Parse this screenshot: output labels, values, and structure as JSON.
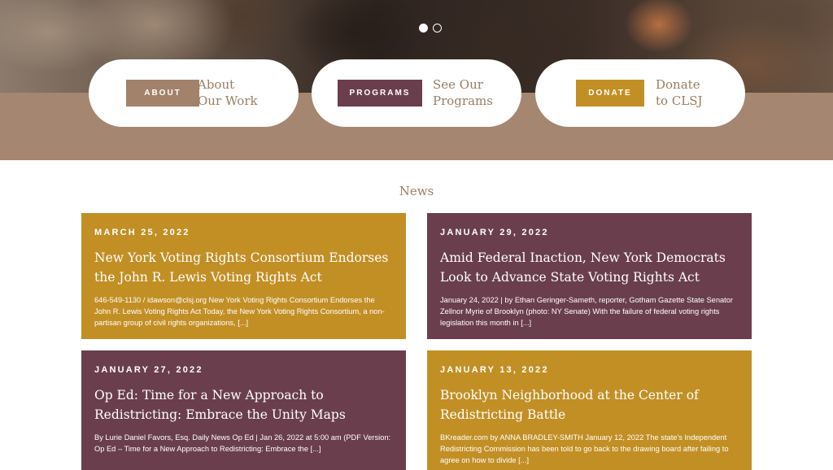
{
  "carousel": {
    "slides": 2,
    "active": 0
  },
  "nav_pills": [
    {
      "tag": "ABOUT",
      "text": "About\nOur Work",
      "color": "#a2826a"
    },
    {
      "tag": "PROGRAMS",
      "text": "See Our\nPrograms",
      "color": "#6a3e4d"
    },
    {
      "tag": "DONATE",
      "text": "Donate\nto CLSJ",
      "color": "#c28f25"
    }
  ],
  "news": {
    "title": "News",
    "cards": [
      {
        "date": "MARCH 25, 2022",
        "headline": "New York Voting Rights Consortium Endorses the John R. Lewis Voting Rights Act",
        "excerpt": "646-549-1130 / idawson@clsj.org New York Voting Rights Consortium Endorses the John R. Lewis Voting Rights Act Today, the New York Voting Rights Consortium, a non-partisan group of civil rights organizations, [...]",
        "color": "#c28f25"
      },
      {
        "date": "JANUARY 29, 2022",
        "headline": "Amid Federal Inaction, New York Democrats Look to Advance State Voting Rights Act",
        "excerpt": "January 24, 2022 | by Ethan Geringer-Sameth, reporter, Gotham Gazette State Senator Zellnor Myrie of Brooklyn (photo: NY Senate) With the failure of federal voting rights legislation this month in [...]",
        "color": "#6a3e4d"
      },
      {
        "date": "JANUARY 27, 2022",
        "headline": "Op Ed: Time for a New Approach to Redistricting: Embrace the Unity Maps",
        "excerpt": "By Lurie Daniel Favors, Esq. Daily News Op Ed | Jan 26, 2022 at 5:00 am (PDF Version: Op Ed – Time for a New Approach to Redistricting: Embrace the [...]",
        "color": "#6a3e4d"
      },
      {
        "date": "JANUARY 13, 2022",
        "headline": "Brooklyn Neighborhood at the Center of Redistricting Battle",
        "excerpt": "BKreader.com by ANNA BRADLEY-SMITH January 12, 2022 The state's Independent Redistricting Commission has been told to go back to the drawing board after failing to agree on how to divide [...]",
        "color": "#c28f25"
      }
    ]
  }
}
